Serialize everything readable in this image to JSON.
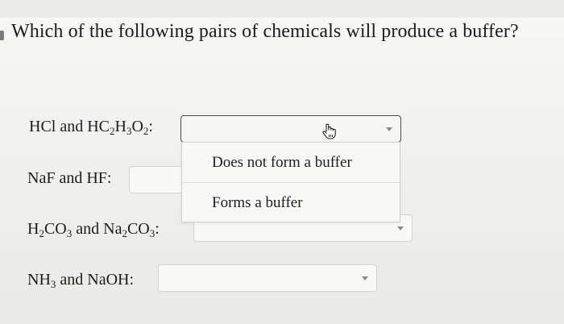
{
  "question": "Which of the following pairs of chemicals will produce a buffer?",
  "rows": [
    {
      "label_parts": [
        "HCl and HC",
        "2",
        "H",
        "3",
        "O",
        "2",
        ":"
      ],
      "selected_value": ""
    },
    {
      "label_parts": [
        "NaF and HF:"
      ],
      "selected_value": ""
    },
    {
      "label_parts": [
        "H",
        "2",
        "CO",
        "3",
        " and Na",
        "2",
        "CO",
        "3",
        ":"
      ],
      "selected_value": ""
    },
    {
      "label_parts": [
        "NH",
        "3",
        " and NaOH:"
      ],
      "selected_value": ""
    }
  ],
  "dropdown": {
    "options": [
      "Does not form a buffer",
      "Forms a buffer"
    ]
  },
  "icons": {
    "cursor": "hand-pointer-icon",
    "caret": "chevron-down-icon"
  },
  "colors": {
    "background": "#f2f2f0",
    "text": "#1c1c1c",
    "border": "#d3d3d1"
  }
}
